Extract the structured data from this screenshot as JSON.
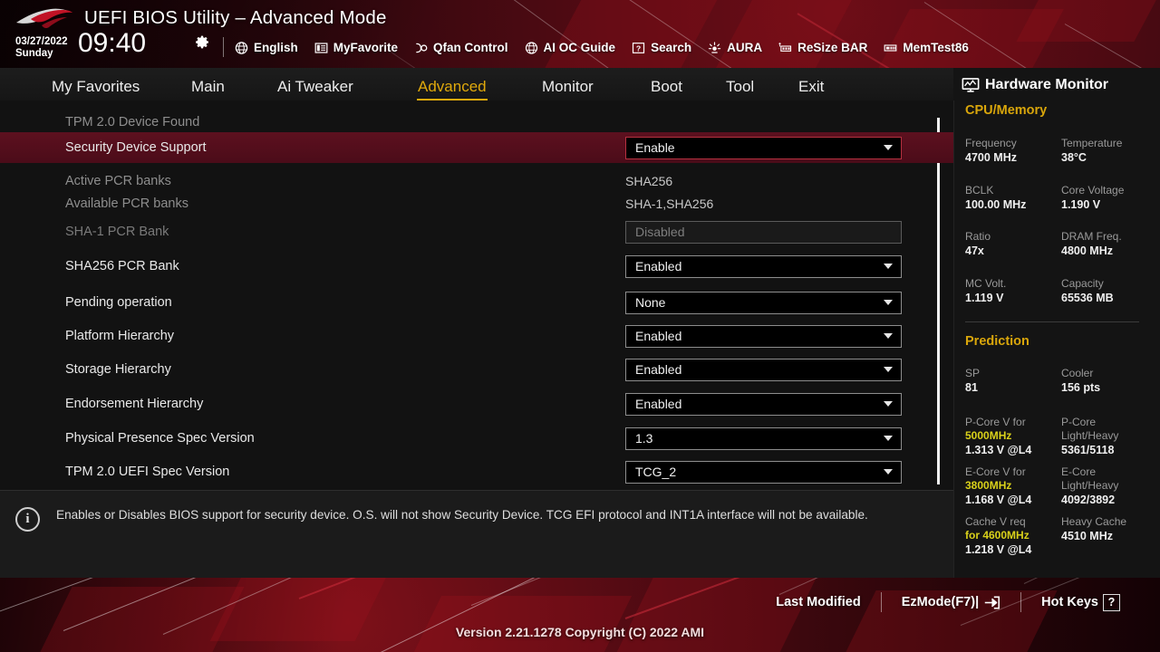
{
  "header": {
    "title": "UEFI BIOS Utility – Advanced Mode",
    "date": "03/27/2022",
    "weekday": "Sunday",
    "time": "09:40",
    "gear_icon": "gear-icon",
    "menu": [
      {
        "label": "English",
        "icon": "globe-icon"
      },
      {
        "label": "MyFavorite",
        "icon": "list-icon"
      },
      {
        "label": "Qfan Control",
        "icon": "fan-icon"
      },
      {
        "label": "AI OC Guide",
        "icon": "globe-icon"
      },
      {
        "label": "Search",
        "icon": "question-box-icon"
      },
      {
        "label": "AURA",
        "icon": "lightbulb-icon"
      },
      {
        "label": "ReSize BAR",
        "icon": "memory-icon"
      },
      {
        "label": "MemTest86",
        "icon": "memtest-icon"
      }
    ]
  },
  "tabs": [
    {
      "label": "My Favorites",
      "active": false
    },
    {
      "label": "Main",
      "active": false
    },
    {
      "label": "Ai Tweaker",
      "active": false
    },
    {
      "label": "Advanced",
      "active": true
    },
    {
      "label": "Monitor",
      "active": false
    },
    {
      "label": "Boot",
      "active": false
    },
    {
      "label": "Tool",
      "active": false
    },
    {
      "label": "Exit",
      "active": false
    }
  ],
  "settings": [
    {
      "label": "TPM 2.0 Device Found",
      "kind": "header",
      "value": ""
    },
    {
      "label": "Security Device Support",
      "kind": "dropdown",
      "value": "Enable",
      "selected": true
    },
    {
      "label": "Active PCR banks",
      "kind": "readonly",
      "value": "SHA256"
    },
    {
      "label": "Available PCR banks",
      "kind": "readonly",
      "value": "SHA-1,SHA256"
    },
    {
      "label": "SHA-1 PCR Bank",
      "kind": "disabled",
      "value": "Disabled"
    },
    {
      "label": "SHA256 PCR Bank",
      "kind": "dropdown",
      "value": "Enabled"
    },
    {
      "label": "Pending operation",
      "kind": "dropdown",
      "value": "None"
    },
    {
      "label": "Platform Hierarchy",
      "kind": "dropdown",
      "value": "Enabled"
    },
    {
      "label": "Storage Hierarchy",
      "kind": "dropdown",
      "value": "Enabled"
    },
    {
      "label": "Endorsement Hierarchy",
      "kind": "dropdown",
      "value": "Enabled"
    },
    {
      "label": "Physical Presence Spec Version",
      "kind": "dropdown",
      "value": "1.3"
    },
    {
      "label": "TPM 2.0 UEFI Spec Version",
      "kind": "dropdown",
      "value": "TCG_2"
    }
  ],
  "help": {
    "icon": "info-icon",
    "text": "Enables or Disables BIOS support for security device. O.S. will not show Security Device. TCG EFI protocol and INT1A interface will not be available."
  },
  "sidebar": {
    "title": "Hardware Monitor",
    "icon": "monitor-icon",
    "sections": [
      {
        "heading": "CPU/Memory",
        "pairs": [
          {
            "k1": "Frequency",
            "v1": "4700 MHz",
            "k2": "Temperature",
            "v2": "38°C"
          },
          {
            "k1": "BCLK",
            "v1": "100.00 MHz",
            "k2": "Core Voltage",
            "v2": "1.190 V"
          },
          {
            "k1": "Ratio",
            "v1": "47x",
            "k2": "DRAM Freq.",
            "v2": "4800 MHz"
          },
          {
            "k1": "MC Volt.",
            "v1": "1.119 V",
            "k2": "Capacity",
            "v2": "65536 MB"
          }
        ]
      },
      {
        "heading": "Prediction",
        "pairs": [
          {
            "k1": "SP",
            "v1": "81",
            "k2": "Cooler",
            "v2": "156 pts"
          }
        ],
        "predictions": [
          {
            "k1a": "P-Core V for",
            "k1b": "5000MHz",
            "v1": "1.313 V @L4",
            "k2a": "P-Core",
            "k2b": "Light/Heavy",
            "v2": "5361/5118"
          },
          {
            "k1a": "E-Core V for",
            "k1b": "3800MHz",
            "v1": "1.168 V @L4",
            "k2a": "E-Core",
            "k2b": "Light/Heavy",
            "v2": "4092/3892"
          },
          {
            "k1a": "Cache V req",
            "k1b": "for 4600MHz",
            "v1": "1.218 V @L4",
            "k2a": "Heavy Cache",
            "k2b": "",
            "v2": "4510 MHz"
          }
        ]
      }
    ]
  },
  "footer": {
    "buttons": [
      {
        "label": "Last Modified",
        "key": ""
      },
      {
        "label": "EzMode(F7)|",
        "key": "arrow-icon"
      },
      {
        "label": "Hot Keys",
        "key": "?"
      }
    ],
    "version": "Version 2.21.1278 Copyright (C) 2022 AMI"
  },
  "colors": {
    "accent_gold": "#e0a90c",
    "highlight_row": "#5d101f",
    "yellow_value": "#d9d11a"
  }
}
